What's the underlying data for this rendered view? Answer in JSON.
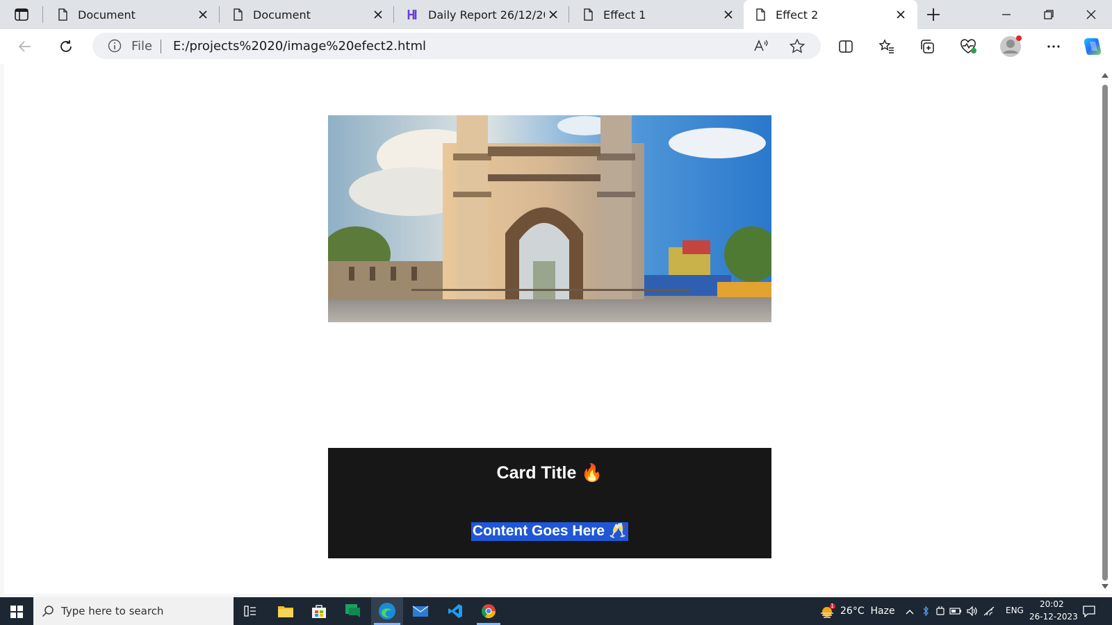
{
  "browser": {
    "tabs": [
      {
        "title": "Document",
        "icon": "page-icon"
      },
      {
        "title": "Document",
        "icon": "page-icon"
      },
      {
        "title": "Daily Report 26/12/202",
        "icon": "hashnode-icon"
      },
      {
        "title": "Effect 1",
        "icon": "page-icon"
      },
      {
        "title": "Effect 2",
        "icon": "page-icon",
        "active": true
      }
    ],
    "address": {
      "scheme_label": "File",
      "url": "E:/projects%2020/image%20efect2.html"
    }
  },
  "page": {
    "hero_image_alt": "Charminar monument",
    "card": {
      "title": "Card Title 🔥",
      "content": "Content Goes Here 🥂"
    }
  },
  "taskbar": {
    "search_placeholder": "Type here to search",
    "weather": "26°C  Haze",
    "language": "ENG",
    "time": "20:02",
    "date": "26-12-2023",
    "notification_count": "1"
  },
  "colors": {
    "card_bg": "#171717",
    "selection": "#1f57d6",
    "taskbar_bg": "#1c2733"
  }
}
